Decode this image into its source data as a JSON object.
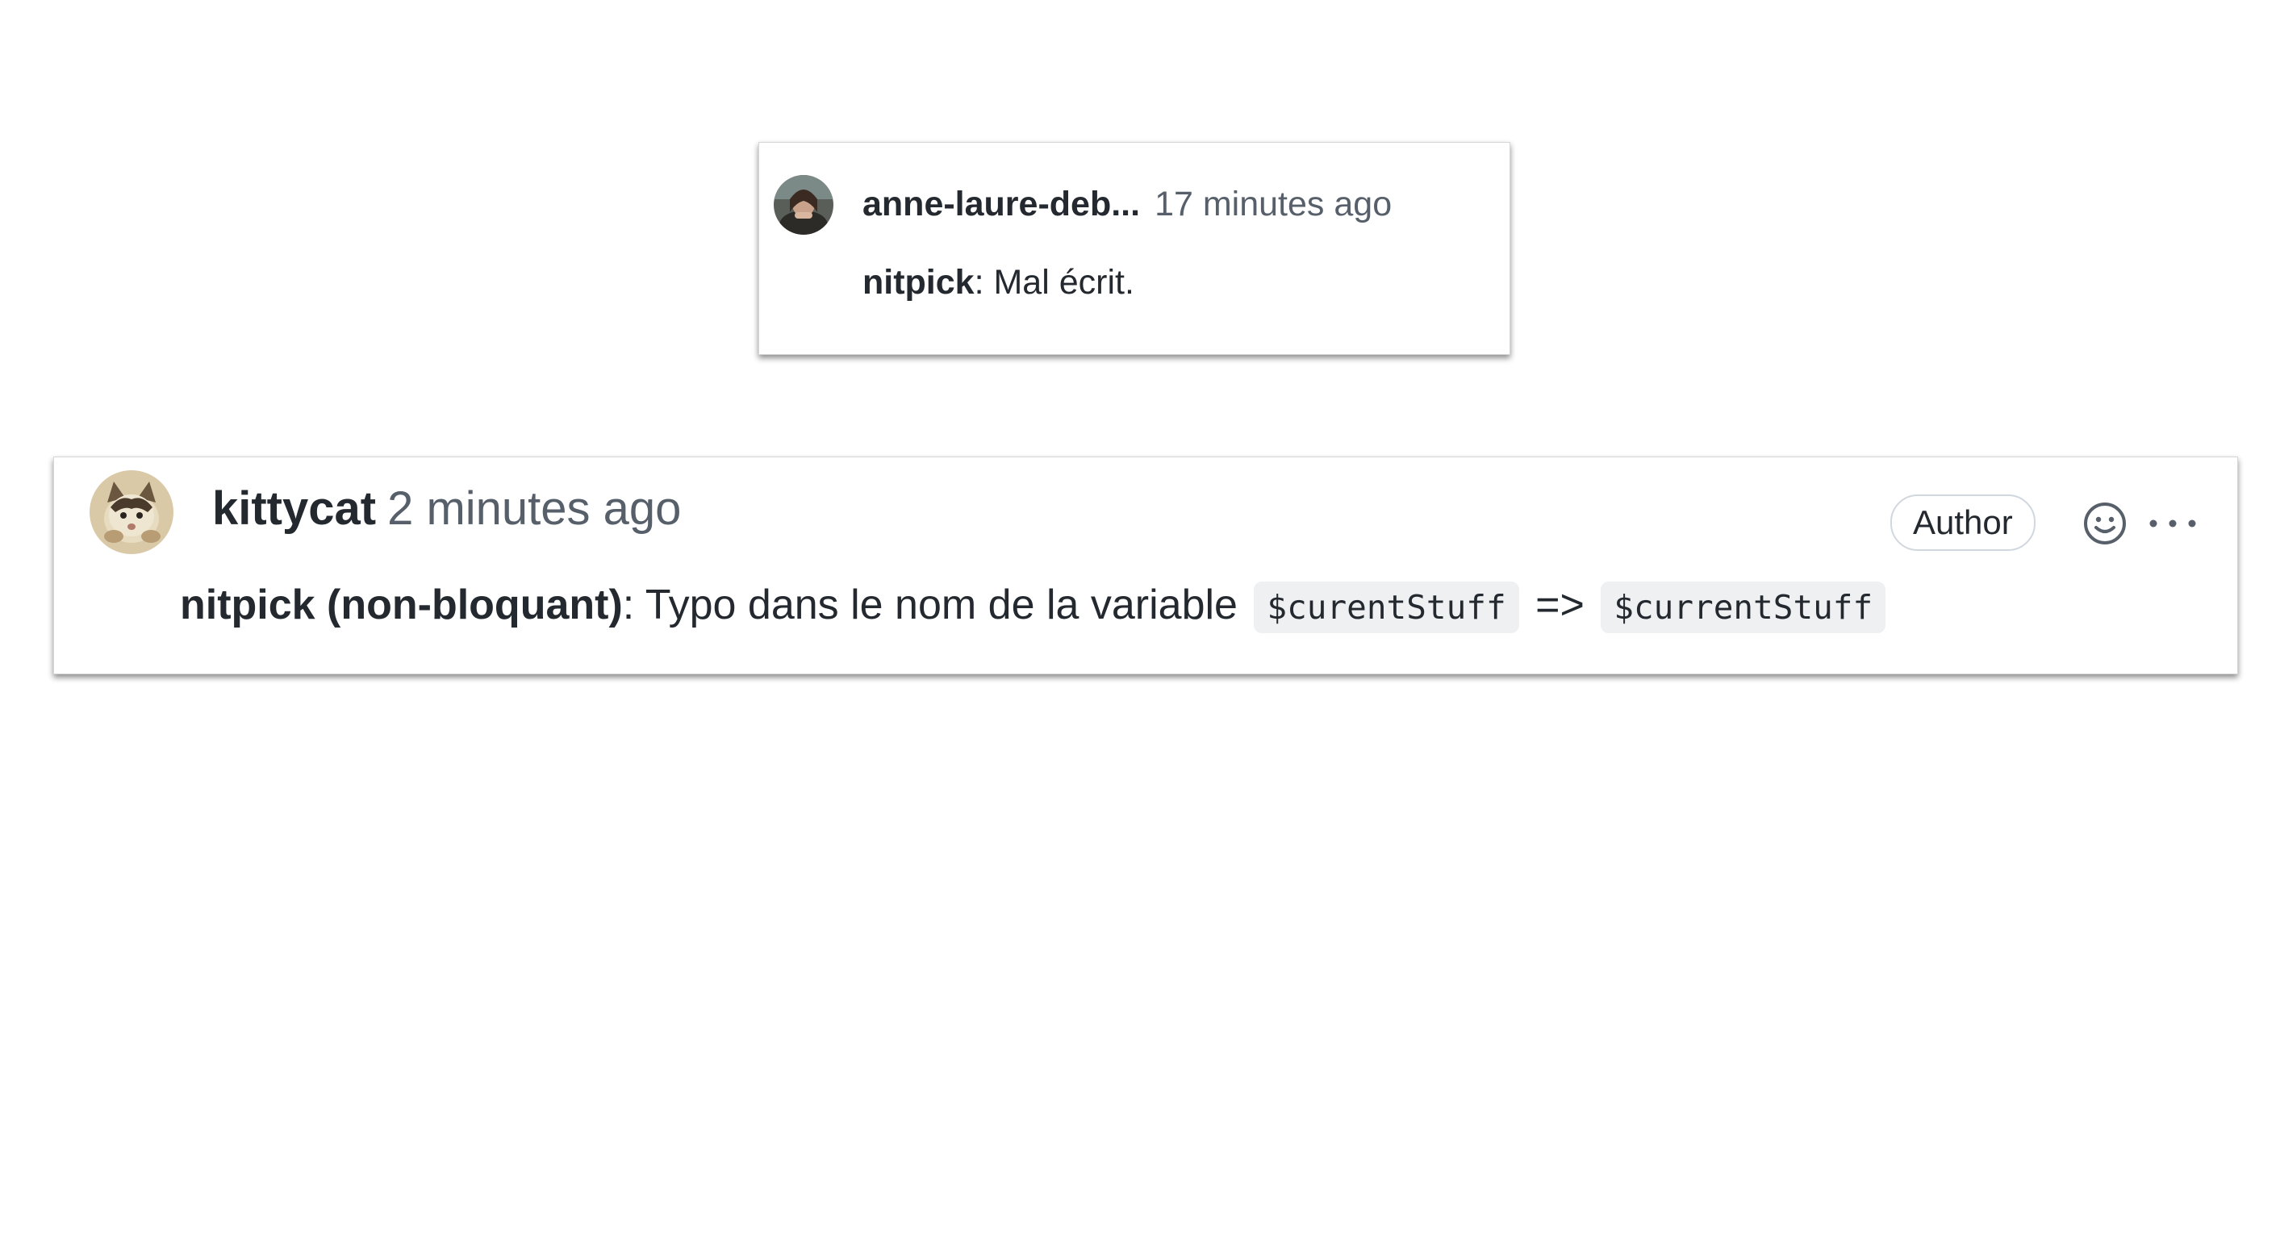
{
  "comments": [
    {
      "author": "anne-laure-deb...",
      "time": "17 minutes ago",
      "label": "nitpick",
      "separator": ":",
      "text": " Mal écrit."
    },
    {
      "author": "kittycat",
      "time": "2 minutes ago",
      "badge": "Author",
      "label": "nitpick (non-bloquant)",
      "separator": ":",
      "text": " Typo dans le nom de la variable ",
      "code_before": "$curentStuff",
      "arrow": "=>",
      "code_after": "$currentStuff",
      "actions": {
        "emoji_icon": "smiley-icon",
        "more_icon": "kebab-horizontal-icon"
      }
    }
  ],
  "colors": {
    "text": "#24292f",
    "muted": "#57606a",
    "code_bg": "#eef0f2",
    "badge_border": "#d0d7de"
  }
}
